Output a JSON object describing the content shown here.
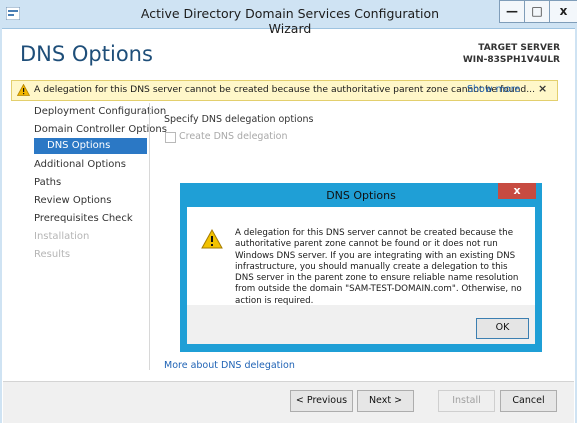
{
  "window": {
    "title": "Active Directory Domain Services Configuration Wizard",
    "min_label": "—",
    "max_label": "□",
    "close_label": "x"
  },
  "header": {
    "page_title": "DNS Options",
    "target_label": "TARGET SERVER",
    "target_name": "WIN-83SPH1V4ULR"
  },
  "warning_bar": {
    "text": "A delegation for this DNS server cannot be created because the authoritative parent zone cannot be found...",
    "link": "Show more",
    "close": "×",
    "color": "#fff7c9"
  },
  "nav": {
    "items": [
      {
        "label": "Deployment Configuration"
      },
      {
        "label": "Domain Controller Options"
      },
      {
        "label": "DNS Options"
      },
      {
        "label": "Additional Options"
      },
      {
        "label": "Paths"
      },
      {
        "label": "Review Options"
      },
      {
        "label": "Prerequisites Check"
      },
      {
        "label": "Installation"
      },
      {
        "label": "Results"
      }
    ],
    "active_color": "#2b78c5"
  },
  "content": {
    "section_label": "Specify DNS delegation options",
    "checkbox_label": "Create DNS delegation",
    "more_link": "More about DNS delegation"
  },
  "buttons": {
    "previous": "< Previous",
    "next": "Next >",
    "install": "Install",
    "cancel": "Cancel"
  },
  "dialog": {
    "title": "DNS Options",
    "close": "x",
    "message": "A delegation for this DNS server cannot be created because the authoritative parent zone cannot be found or it does not run Windows DNS server. If you are integrating with an existing DNS infrastructure, you should manually create a delegation to this DNS server in the parent zone to ensure reliable name resolution from outside the domain \"SAM-TEST-DOMAIN.com\". Otherwise, no action is required.",
    "ok": "OK",
    "border_color": "#1f9fd6"
  }
}
